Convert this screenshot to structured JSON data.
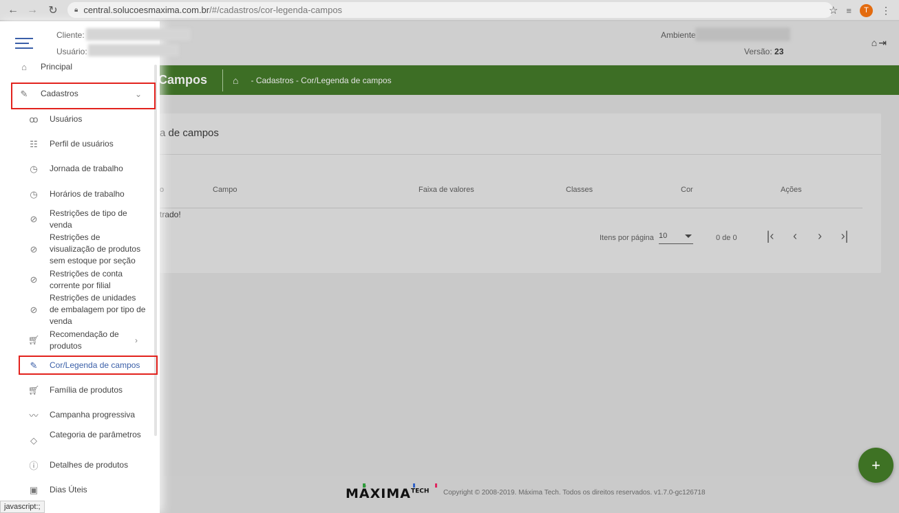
{
  "browser": {
    "url_host": "central.solucoesmaxima.com.br",
    "url_path": "/#/cadastros/cor-legenda-campos",
    "avatar_initial": "T",
    "status_bar": "javascript:;"
  },
  "header": {
    "cliente_label": "Cliente:",
    "usuario_label": "Usuário:",
    "ambiente_label": "Ambiente",
    "versao_label": "Versão:",
    "versao_value": "23"
  },
  "banner": {
    "title": "Campos",
    "breadcrumb": "- Cadastros - Cor/Legenda de campos"
  },
  "card": {
    "title": "a de campos",
    "columns": [
      "o",
      "Campo",
      "Faixa de valores",
      "Classes",
      "Cor",
      "Ações"
    ],
    "empty_text": "trado!",
    "pagination": {
      "items_per_page_label": "Itens por página",
      "items_per_page_value": "10",
      "range": "0 de 0"
    }
  },
  "sidebar": {
    "items": [
      {
        "label": "Principal",
        "icon": "home-icon"
      },
      {
        "label": "Cadastros",
        "icon": "edit-icon"
      },
      {
        "label": "Usuários",
        "icon": "users-icon"
      },
      {
        "label": "Perfil de usuários",
        "icon": "checklist-icon"
      },
      {
        "label": "Jornada de trabalho",
        "icon": "clock-icon"
      },
      {
        "label": "Horários de trabalho",
        "icon": "clock-icon"
      },
      {
        "label": "Restrições de tipo de venda",
        "icon": "block-icon"
      },
      {
        "label": "Restrições de visualização de produtos sem estoque por seção",
        "icon": "block-icon"
      },
      {
        "label": "Restrições de conta corrente por filial",
        "icon": "block-icon"
      },
      {
        "label": "Restrições de unidades de embalagem por tipo de venda",
        "icon": "block-icon"
      },
      {
        "label": "Recomendação de produtos",
        "icon": "cart-icon"
      },
      {
        "label": "Cor/Legenda de campos",
        "icon": "pen-icon"
      },
      {
        "label": "Família de produtos",
        "icon": "cart-icon"
      },
      {
        "label": "Campanha progressiva",
        "icon": "trend-icon"
      },
      {
        "label": "Categoria de parâmetros",
        "icon": "tag-icon"
      },
      {
        "label": "Detalhes de produtos",
        "icon": "info-icon"
      },
      {
        "label": "Dias Úteis",
        "icon": "calendar-icon"
      }
    ]
  },
  "footer": {
    "logo": "MÁXIMA",
    "logo_suffix": "TECH",
    "copyright": "Copyright © 2008-2019. Máxima Tech. Todos os direitos reservados. v1.7.0-gc126718"
  },
  "colors": {
    "banner_green": "#3d6e25",
    "fab_green": "#3e7224",
    "highlight_red": "#e2211c",
    "active_blue": "#3a5fa8"
  }
}
